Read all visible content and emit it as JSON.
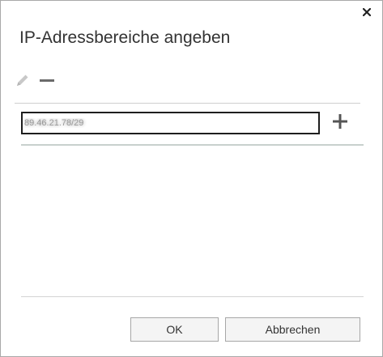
{
  "dialog": {
    "title": "IP-Adressbereiche angeben",
    "close_icon": "close-icon"
  },
  "toolbar": {
    "edit_icon": "pencil-icon",
    "remove_icon": "minus-icon"
  },
  "ip_entry": {
    "value": "89.46.21.78/29",
    "add_icon": "plus-icon"
  },
  "ip_list": {
    "items": []
  },
  "buttons": {
    "ok_label": "OK",
    "cancel_label": "Abbrechen"
  },
  "colors": {
    "border": "#a9a9a9",
    "input_border": "#1e1e1e",
    "separator": "#c8d0cd",
    "icon_dark": "#555555",
    "icon_disabled": "#c8c8c8",
    "button_bg": "#f4f4f4"
  }
}
